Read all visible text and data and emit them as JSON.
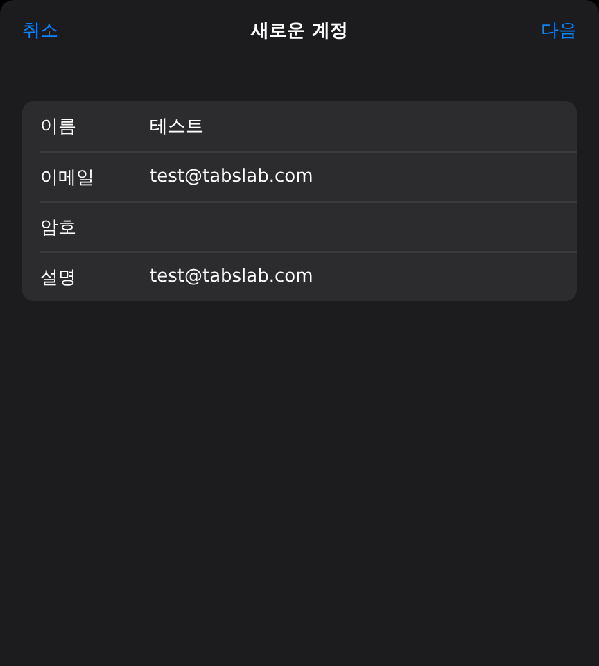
{
  "nav_bar": {
    "cancel": "취소",
    "title": "새로운 계정",
    "next": "다음"
  },
  "form": {
    "fields": [
      {
        "label": "이름",
        "value": "테스트"
      },
      {
        "label": "이메일",
        "value": "test@tabslab.com"
      },
      {
        "label": "암호"
      },
      {
        "label": "설명",
        "value": "test@tabslab.com"
      }
    ]
  }
}
